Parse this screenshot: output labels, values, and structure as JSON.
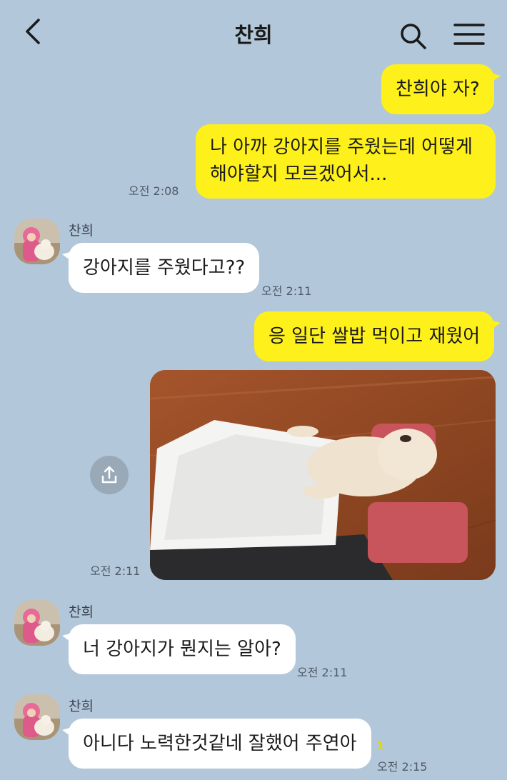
{
  "header": {
    "title": "찬희",
    "back_icon": "chevron-left-icon",
    "search_icon": "search-icon",
    "menu_icon": "hamburger-menu-icon"
  },
  "colors": {
    "background": "#b2c7da",
    "my_bubble": "#fef01b",
    "other_bubble": "#ffffff",
    "read_count": "#e2d80b"
  },
  "messages": [
    {
      "from": "me",
      "text": "찬희야 자?"
    },
    {
      "from": "me",
      "lines": [
        "나 아까 강아지를 주웠는데 어떻게",
        "해야할지 모르겠어서..."
      ],
      "time": "오전 2:08"
    },
    {
      "from": "other",
      "sender": "찬희",
      "text": "강아지를 주웠다고??",
      "time": "오전 2:11"
    },
    {
      "from": "me",
      "text": "응 일단 쌀밥 먹이고 재웠어"
    },
    {
      "from": "me",
      "type": "photo",
      "photo_alt": "puppy sleeping under a tissue blanket on a red towel pillow",
      "time": "오전 2:11",
      "share_icon": "share-icon"
    },
    {
      "from": "other",
      "sender": "찬희",
      "text": "너 강아지가 뭔지는 알아?",
      "time": "오전 2:11"
    },
    {
      "from": "other",
      "sender": "찬희",
      "text": "아니다 노력한것같네 잘했어 주연아",
      "time": "오전 2:15",
      "read_count": "1"
    }
  ]
}
